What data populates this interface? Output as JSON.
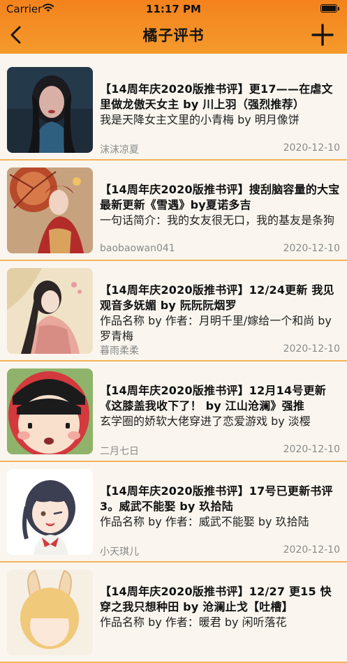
{
  "status_bar": {
    "carrier": "Carrier",
    "time": "11:17 PM"
  },
  "nav": {
    "title": "橘子评书",
    "back_icon": "chevron-left-icon",
    "add_icon": "plus-icon"
  },
  "colors": {
    "header_top": "#f4821d",
    "header_bottom": "#f49a2c",
    "divider": "#f3b25c",
    "background": "#faf6ef"
  },
  "items": [
    {
      "title": "【14周年庆2020版推书评】更17——在虐文里做龙傲天女主 by 川上羽（强烈推荐）",
      "summary": "我是天降女主文里的小青梅 by 明月像饼",
      "author": "沫沫凉夏",
      "date": "2020-12-10"
    },
    {
      "title": "【14周年庆2020版推书评】搜刮脑容量的大宝 最新更新《雪遇》by夏诺多吉",
      "summary": "一句话简介：我的女友很无口，我的基友是条狗",
      "author": "baobaowan041",
      "date": "2020-12-10"
    },
    {
      "title": "【14周年庆2020版推书评】12/24更新 我见观音多妩媚 by 阮阮阮烟罗",
      "summary": "作品名称 by 作者：月明千里/嫁给一个和尚 by 罗青梅",
      "author": "暮雨柔柔",
      "date": "2020-12-10"
    },
    {
      "title": "【14周年庆2020版推书评】12月14号更新《这膝盖我收下了！ by 江山沧澜》强推",
      "summary": "玄学圈的娇软大佬穿进了恋爱游戏 by 淡樱",
      "author": "二月七日",
      "date": "2020-12-10"
    },
    {
      "title": "【14周年庆2020版推书评】17号已更新书评3。威武不能娶 by 玖拾陆",
      "summary": "作品名称 by 作者：威武不能娶 by 玖拾陆",
      "author": "小天琪儿",
      "date": "2020-12-10"
    },
    {
      "title": "【14周年庆2020版推书评】12/27 更15 快穿之我只想种田 by 沧澜止戈【吐槽】",
      "summary": "作品名称 by 作者：暖君 by 闲听落花",
      "author": "",
      "date": ""
    }
  ]
}
